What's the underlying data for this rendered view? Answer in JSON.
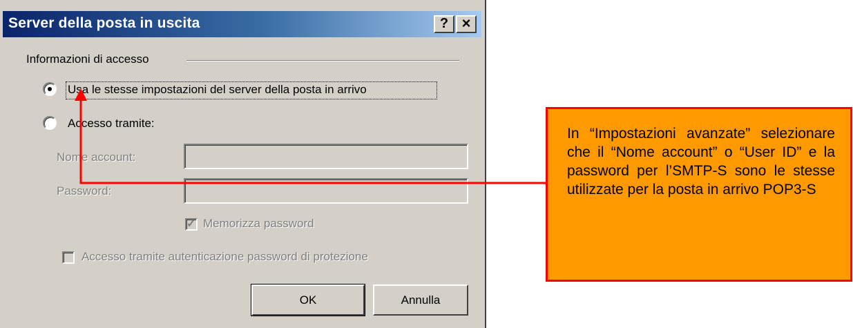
{
  "dialog": {
    "title": "Server della posta in uscita",
    "help_button": "?",
    "close_button": "×",
    "group_label": "Informazioni di accesso",
    "option_same_settings": "Usa le stesse impostazioni del server della posta in arrivo",
    "option_same_settings_selected": true,
    "option_access_via": "Accesso tramite:",
    "option_access_via_selected": false,
    "account_label": "Nome account:",
    "account_value": "",
    "password_label": "Password:",
    "password_value": "",
    "remember_password_label": "Memorizza password",
    "remember_password_checked": true,
    "spa_label": "Accesso tramite autenticazione password di protezione",
    "spa_checked": false,
    "ok_label": "OK",
    "cancel_label": "Annulla"
  },
  "annotation": {
    "text": "In “Impostazioni avanzate” selezionare che il “Nome account” o “User ID” e la password per l’SMTP-S sono le stesse utilizzate per la posta in arrivo POP3-S"
  },
  "colors": {
    "dialog_bg": "#d4d0c8",
    "title_start": "#0a246a",
    "title_end": "#a6caf0",
    "callout_bg": "#ff9900",
    "callout_border": "#ff0000",
    "arrow": "#ff0000"
  }
}
